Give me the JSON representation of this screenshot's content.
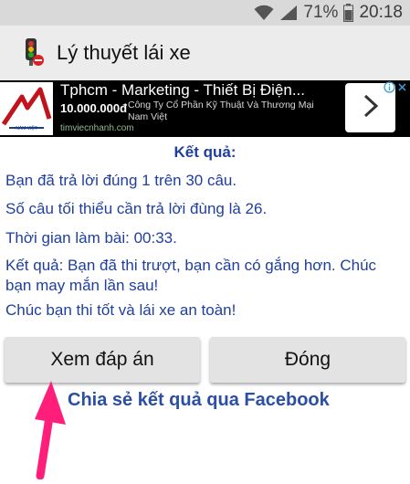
{
  "status_bar": {
    "battery": "71%",
    "time": "20:18"
  },
  "app_bar": {
    "title": "Lý thuyết lái xe"
  },
  "ad": {
    "title": "Tphcm - Marketing - Thiết Bị Điện...",
    "price": "10.000.000đ",
    "company": "Công Ty Cổ Phần Kỹ Thuật Và Thương Mại Nam Việt",
    "url": "timviecnhanh.com",
    "thumb_caption": "NAM VIỆT"
  },
  "results": {
    "heading": "Kết quả:",
    "lines": [
      "Bạn đã trả lời đúng 1 trên 30 câu.",
      "Số câu tối thiểu cần trả lời đùng là 26.",
      "Thời gian làm bài: 00:33.",
      "Kết quả: Bạn đã thi trượt, bạn cần có gắng hơn. Chúc bạn may mắn lần sau!",
      "Chúc bạn thi tốt và lái xe an toàn!"
    ]
  },
  "buttons": {
    "view_answers": "Xem đáp án",
    "close": "Đóng"
  },
  "share": {
    "facebook_label": "Chia sẻ kết quả qua Facebook"
  },
  "colors": {
    "text_blue": "#1f3f9f",
    "link_blue": "#2a4fa3",
    "arrow_pink": "#ff1f7a"
  }
}
